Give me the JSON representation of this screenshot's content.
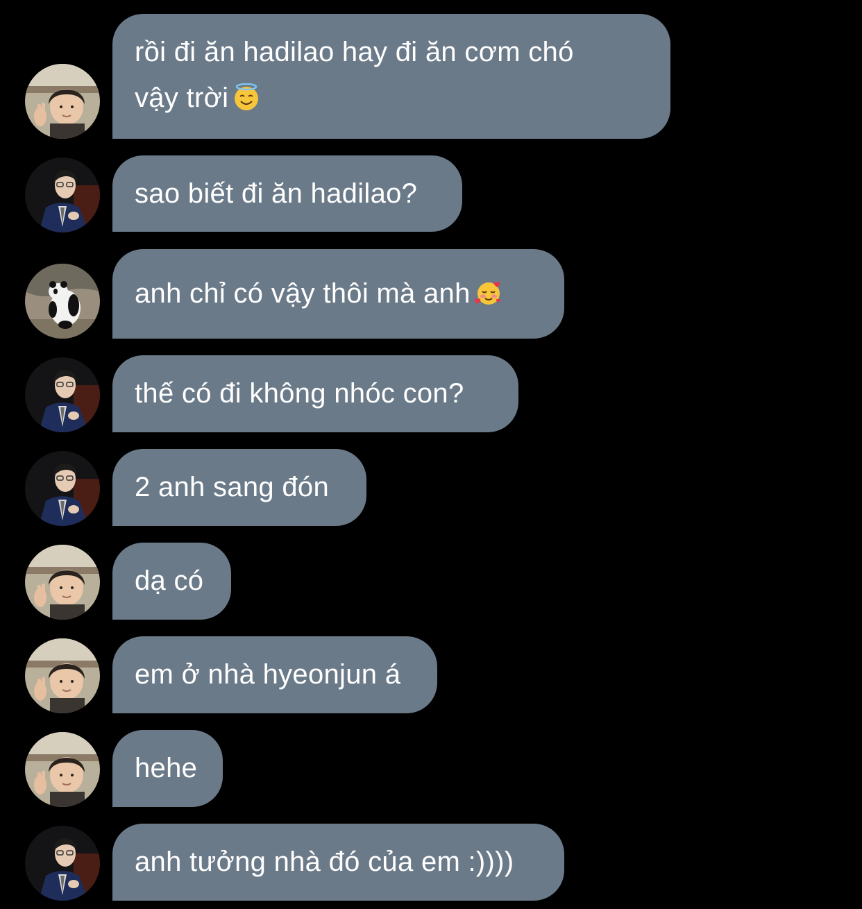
{
  "messages": [
    {
      "sender": "kid-avatar",
      "lines": [
        "rồi đi ăn hadilao hay đi ăn cơm chó",
        "vậy trời"
      ],
      "emoji": "smiling-face-with-halo-icon"
    },
    {
      "sender": "suit-avatar",
      "lines": [
        "sao biết đi ăn hadilao?"
      ],
      "emoji": ""
    },
    {
      "sender": "panda-avatar",
      "lines": [
        "anh chỉ có vậy thôi mà anh"
      ],
      "emoji": "smiling-face-with-hearts-icon"
    },
    {
      "sender": "suit-avatar",
      "lines": [
        "thế có đi không nhóc con?"
      ],
      "emoji": ""
    },
    {
      "sender": "suit-avatar",
      "lines": [
        "2 anh sang đón"
      ],
      "emoji": ""
    },
    {
      "sender": "kid-avatar",
      "lines": [
        "dạ có"
      ],
      "emoji": ""
    },
    {
      "sender": "kid-avatar",
      "lines": [
        "em ở nhà hyeonjun á"
      ],
      "emoji": ""
    },
    {
      "sender": "kid-avatar",
      "lines": [
        "hehe"
      ],
      "emoji": ""
    },
    {
      "sender": "suit-avatar",
      "lines": [
        "anh tưởng nhà đó của em :))))"
      ],
      "emoji": ""
    }
  ],
  "colors": {
    "background": "#000000",
    "bubble": "#6b7a89",
    "text": "#ffffff"
  }
}
